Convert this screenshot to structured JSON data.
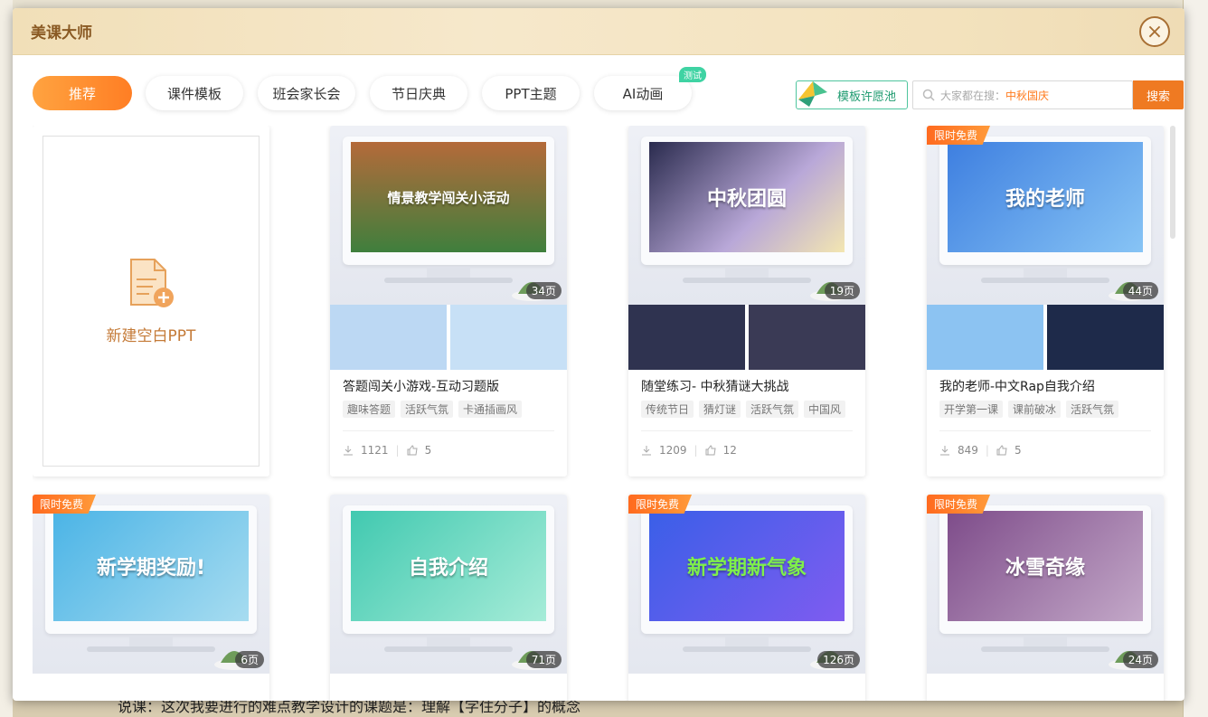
{
  "window": {
    "title": "美课大师",
    "close_glyph": "×"
  },
  "tabs": [
    {
      "label": "推荐",
      "active": true
    },
    {
      "label": "课件模板"
    },
    {
      "label": "班会家长会"
    },
    {
      "label": "节日庆典"
    },
    {
      "label": "PPT主题"
    },
    {
      "label": "AI动画",
      "badge": "测试"
    }
  ],
  "wish_pool": {
    "label": "模板许愿池",
    "icon": "paper-crane-icon"
  },
  "search": {
    "prefix": "大家都在搜：",
    "hot_term": "中秋国庆",
    "button": "搜索",
    "icon": "search-icon"
  },
  "new_blank": {
    "label": "新建空白PPT",
    "icon": "new-document-icon"
  },
  "cards": [
    {
      "name": "答题闯关小游戏-互动习题版",
      "pages": "34页",
      "tags": [
        "趣味答题",
        "活跃气氛",
        "卡通插画风"
      ],
      "downloads": "1121",
      "likes": "5",
      "screen_text": "情景教学闯关小活动",
      "free_badge": ""
    },
    {
      "name": "随堂练习- 中秋猜谜大挑战",
      "pages": "19页",
      "tags": [
        "传统节日",
        "猜灯谜",
        "活跃气氛",
        "中国风"
      ],
      "downloads": "1209",
      "likes": "12",
      "screen_text": "中秋团圆",
      "free_badge": ""
    },
    {
      "name": "我的老师-中文Rap自我介绍",
      "pages": "44页",
      "tags": [
        "开学第一课",
        "课前破冰",
        "活跃气氛"
      ],
      "downloads": "849",
      "likes": "5",
      "screen_text": "我的老师",
      "free_badge": "限时免费"
    },
    {
      "name": "",
      "pages": "6页",
      "tags": [],
      "downloads": "",
      "likes": "",
      "screen_text": "新学期奖励!",
      "free_badge": "限时免费"
    },
    {
      "name": "",
      "pages": "71页",
      "tags": [],
      "downloads": "",
      "likes": "",
      "screen_text": "自我介绍",
      "free_badge": ""
    },
    {
      "name": "",
      "pages": "126页",
      "tags": [],
      "downloads": "",
      "likes": "",
      "screen_text": "新学期新气象",
      "free_badge": "限时免费"
    },
    {
      "name": "",
      "pages": "24页",
      "tags": [],
      "downloads": "",
      "likes": "",
      "screen_text": "冰雪奇缘",
      "free_badge": "限时免费"
    }
  ],
  "background": {
    "bottom_text": "说课：这次我要进行的难点教学设计的课题是：理解【字住分子】的概念"
  },
  "colors": {
    "accent": "#ff7e24",
    "title": "#8a5a24",
    "wish": "#1f9b70"
  }
}
